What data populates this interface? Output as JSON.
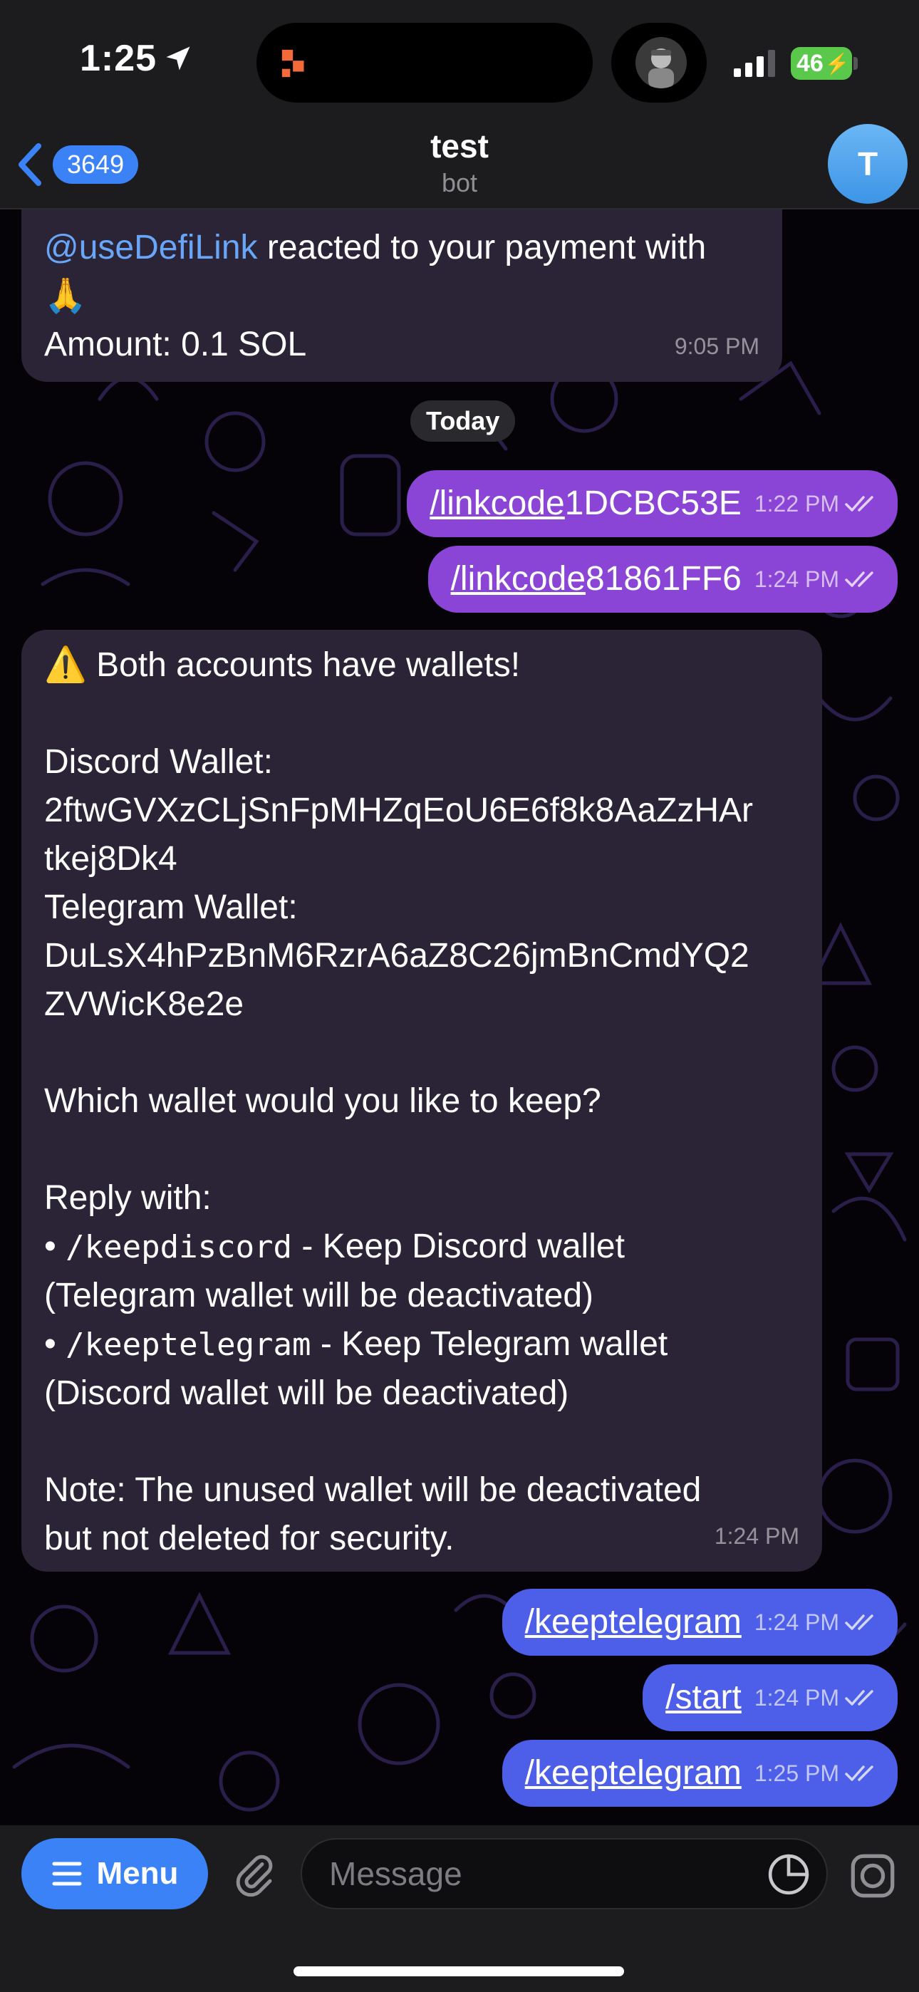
{
  "status_bar": {
    "time": "1:25",
    "battery": "46",
    "icons": [
      "location-arrow-icon",
      "signal-bars-icon",
      "battery-charging-icon"
    ]
  },
  "header": {
    "back_count": "3649",
    "title": "test",
    "subtitle": "bot",
    "avatar_letter": "T"
  },
  "messages": {
    "m0": {
      "mention": "@useDefiLink",
      "text_line1": " reacted to your payment with",
      "emoji": "🙏",
      "amount": "Amount: 0.1 SOL",
      "time": "9:05 PM"
    },
    "date_separator": "Today",
    "m1": {
      "command": "/linkcode",
      "arg": " 1DCBC53E",
      "time": "1:22 PM"
    },
    "m2": {
      "command": "/linkcode",
      "arg": " 81861FF6",
      "time": "1:24 PM"
    },
    "m3": {
      "l1": "⚠️ Both accounts have wallets!",
      "l2": "Discord Wallet:",
      "l3": "2ftwGVXzCLjSnFpMHZqEoU6E6f8k8AaZzHAr",
      "l4": "tkej8Dk4",
      "l5": "Telegram Wallet:",
      "l6": "DuLsX4hPzBnM6RzrA6aZ8C26jmBnCmdYQ2",
      "l7": "ZVWicK8e2e",
      "l8": "Which wallet would you like to keep?",
      "l9": "Reply with:",
      "bullet1_cmd": "/keepdiscord",
      "bullet1_text": " - Keep Discord wallet",
      "l11": "(Telegram wallet will be deactivated)",
      "bullet2_cmd": "/keeptelegram",
      "bullet2_text": " - Keep Telegram wallet",
      "l13": "(Discord wallet will be deactivated)",
      "l14": "Note: The unused wallet will be deactivated",
      "l15": "but not deleted for security.",
      "bullet": "•",
      "time": "1:24 PM"
    },
    "m4": {
      "command": "/keeptelegram",
      "time": "1:24 PM"
    },
    "m5": {
      "command": "/start",
      "time": "1:24 PM"
    },
    "m6": {
      "command": "/keeptelegram",
      "time": "1:25 PM"
    }
  },
  "input_bar": {
    "menu_label": "Menu",
    "placeholder": "Message"
  },
  "colors": {
    "accent": "#3b82f6",
    "outgoing_purple": "#8b45d6",
    "outgoing_blue": "#4d5ee8",
    "incoming": "#2a2436",
    "mention": "#6aa6f8",
    "battery": "#5ac84a"
  }
}
